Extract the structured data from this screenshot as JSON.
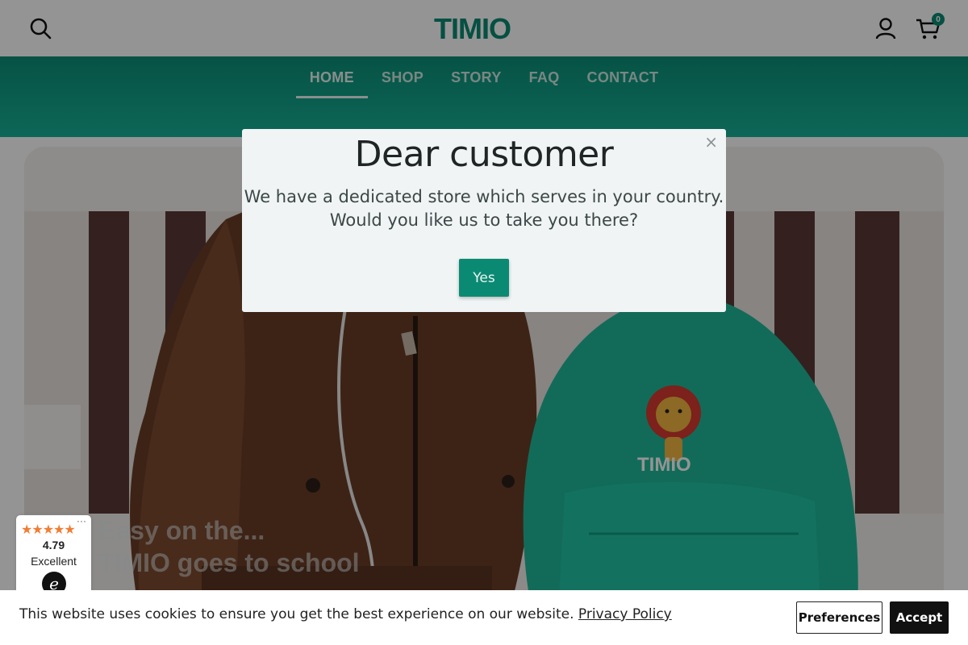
{
  "header": {
    "logo_text": "TIMIO",
    "cart_count": "0",
    "icons": {
      "search": "search-icon",
      "account": "account-icon",
      "cart": "cart-icon"
    }
  },
  "nav": {
    "items": [
      {
        "label": "HOME",
        "active": true
      },
      {
        "label": "SHOP",
        "active": false
      },
      {
        "label": "STORY",
        "active": false
      },
      {
        "label": "FAQ",
        "active": false
      },
      {
        "label": "CONTACT",
        "active": false
      }
    ]
  },
  "hero": {
    "line1": "Easy on the...",
    "line2": "TIMIO goes to school"
  },
  "modal": {
    "title": "Dear customer",
    "body_line1": "We have a dedicated store which serves in your country.",
    "body_line2": "Would you like us to take you there?",
    "yes_label": "Yes",
    "close_glyph": "×"
  },
  "trust": {
    "stars": "★★★★★",
    "score": "4.79",
    "label": "Excellent",
    "logo_glyph": "e",
    "more_glyph": "···"
  },
  "cookie": {
    "text": "This website uses cookies to ensure you get the best experience on our website.",
    "link": "Privacy Policy",
    "preferences_label": "Preferences",
    "accept_label": "Accept"
  },
  "colors": {
    "brand": "#0b8a73",
    "nav_top": "#0b8f78",
    "nav_bottom": "#17b197",
    "star": "#f07d34"
  }
}
